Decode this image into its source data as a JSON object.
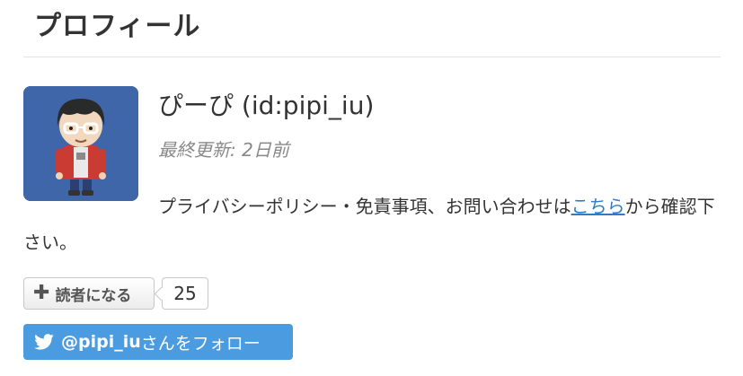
{
  "module": {
    "title": "プロフィール"
  },
  "profile": {
    "name": "ぴーぴ (id:pipi_iu)",
    "updated_label": "最終更新:",
    "updated_value": "2日前",
    "description_before": "プライバシーポリシー・免責事項、お問い合わせは",
    "description_link": "こちら",
    "description_after": "から確認下さい。"
  },
  "reader": {
    "button_label": "読者になる",
    "count": "25",
    "icon": "plus-icon"
  },
  "twitter": {
    "handle": "@pipi_iu",
    "suffix": "さんをフォロー",
    "icon": "twitter-bird-icon",
    "color": "#4a9be0"
  }
}
